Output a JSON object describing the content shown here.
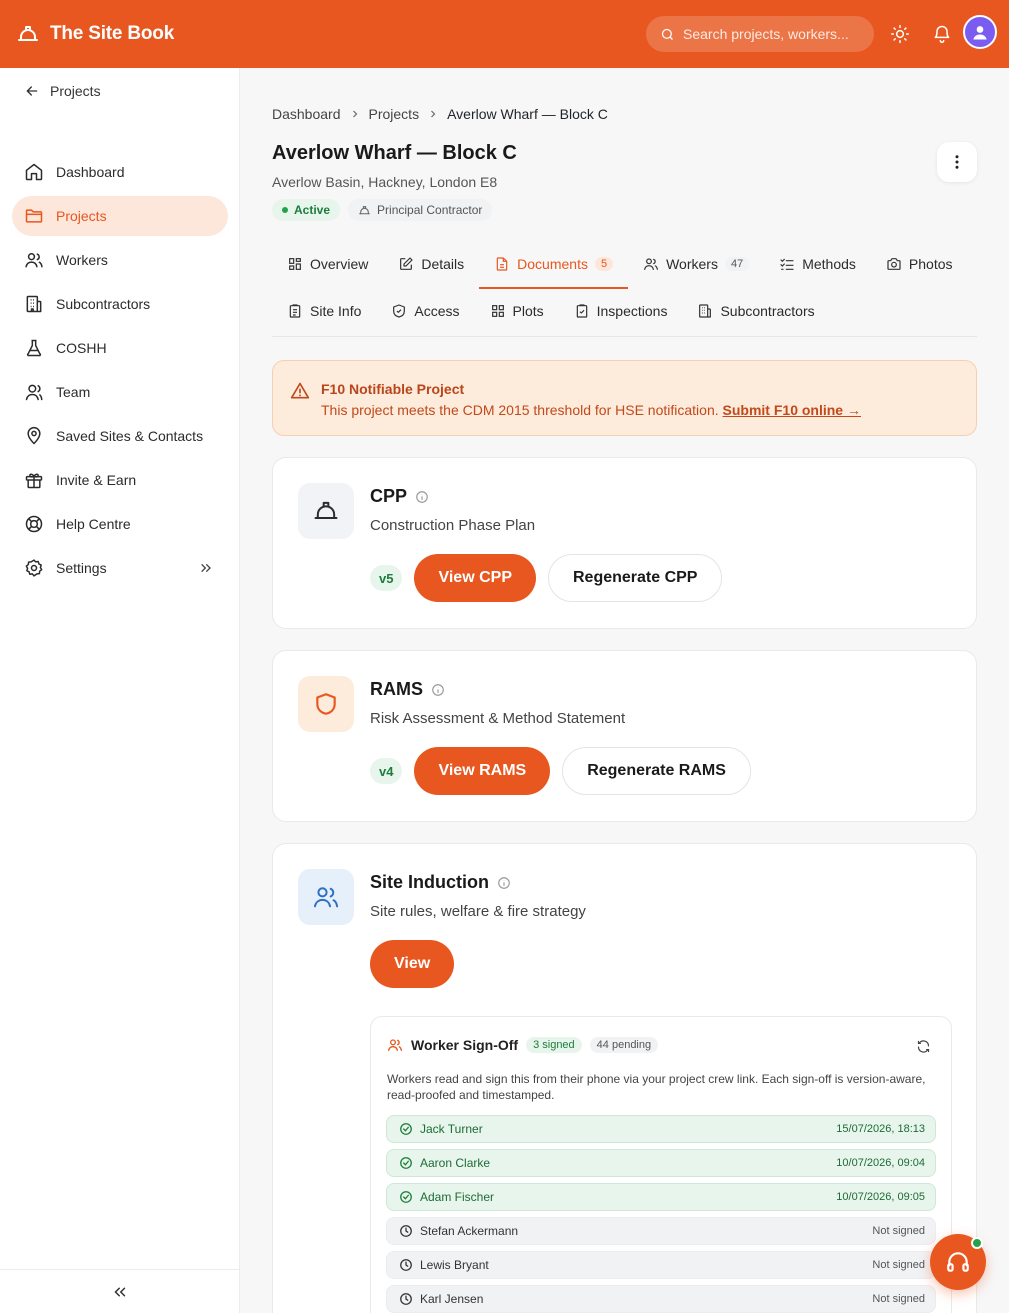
{
  "app": {
    "title": "The Site Book"
  },
  "search": {
    "placeholder": "Search projects, workers..."
  },
  "sidebar": {
    "back_label": "Projects",
    "items": [
      {
        "label": "Dashboard",
        "icon": "home-icon"
      },
      {
        "label": "Projects",
        "icon": "folder-icon",
        "active": true
      },
      {
        "label": "Workers",
        "icon": "users-icon"
      },
      {
        "label": "Subcontractors",
        "icon": "building-icon"
      },
      {
        "label": "COSHH",
        "icon": "flask-icon"
      },
      {
        "label": "Team",
        "icon": "team-icon"
      },
      {
        "label": "Saved Sites & Contacts",
        "icon": "map-pin-icon"
      },
      {
        "label": "Invite & Earn",
        "icon": "gift-icon"
      },
      {
        "label": "Help Centre",
        "icon": "lifebuoy-icon"
      },
      {
        "label": "Settings",
        "icon": "gear-icon"
      }
    ]
  },
  "breadcrumb": [
    "Dashboard",
    "Projects",
    "Averlow Wharf — Block C"
  ],
  "project": {
    "title": "Averlow Wharf — Block C",
    "address": "Averlow Basin, Hackney, London E8",
    "status": "Active",
    "role": "Principal Contractor"
  },
  "tabs_row1": [
    {
      "label": "Overview",
      "icon": "grid-icon"
    },
    {
      "label": "Details",
      "icon": "edit-icon"
    },
    {
      "label": "Documents",
      "icon": "document-icon",
      "count": "5",
      "active": true
    },
    {
      "label": "Workers",
      "icon": "users-icon",
      "count": "47"
    },
    {
      "label": "Methods",
      "icon": "checklist-icon"
    },
    {
      "label": "Photos",
      "icon": "camera-icon"
    }
  ],
  "tabs_row2": [
    {
      "label": "Site Info",
      "icon": "clipboard-icon"
    },
    {
      "label": "Access",
      "icon": "shield-icon"
    },
    {
      "label": "Plots",
      "icon": "grid-icon"
    },
    {
      "label": "Inspections",
      "icon": "clipboard-check-icon"
    },
    {
      "label": "Subcontractors",
      "icon": "building-icon"
    }
  ],
  "alert": {
    "title": "F10 Notifiable Project",
    "text": "This project meets the CDM 2015 threshold for HSE notification.",
    "link": "Submit F10 online →"
  },
  "cards": {
    "cpp": {
      "title": "CPP",
      "subtitle": "Construction Phase Plan",
      "version": "v5",
      "primary": "View CPP",
      "secondary": "Regenerate CPP"
    },
    "rams": {
      "title": "RAMS",
      "subtitle": "Risk Assessment & Method Statement",
      "version": "v4",
      "primary": "View RAMS",
      "secondary": "Regenerate RAMS"
    },
    "induction": {
      "title": "Site Induction",
      "subtitle": "Site rules, welfare & fire strategy",
      "primary": "View"
    }
  },
  "signoff": {
    "title": "Worker Sign-Off",
    "signed_count": "3 signed",
    "pending_count": "44 pending",
    "description": "Workers read and sign this from their phone via your project crew link. Each sign-off is version-aware, read-proofed and timestamped.",
    "rows": [
      {
        "name": "Jack Turner",
        "status": "15/07/2026, 18:13",
        "signed": true
      },
      {
        "name": "Aaron Clarke",
        "status": "10/07/2026, 09:04",
        "signed": true
      },
      {
        "name": "Adam Fischer",
        "status": "10/07/2026, 09:05",
        "signed": true
      },
      {
        "name": "Stefan Ackermann",
        "status": "Not signed",
        "signed": false
      },
      {
        "name": "Lewis Bryant",
        "status": "Not signed",
        "signed": false
      },
      {
        "name": "Karl Jensen",
        "status": "Not signed",
        "signed": false
      }
    ]
  },
  "colors": {
    "brand": "#e8571f",
    "success": "#1d7d3a",
    "alert_bg": "#fdebdc"
  }
}
